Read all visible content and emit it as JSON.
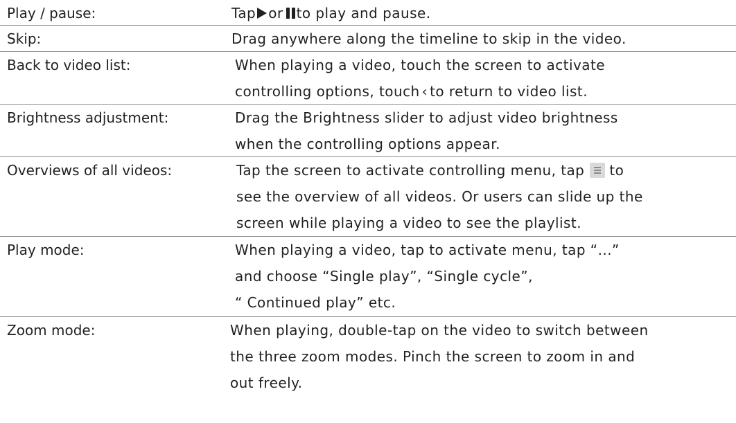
{
  "rows": [
    {
      "label": "Play / pause:",
      "parts": {
        "p1": "Tap",
        "play_icon": "play-icon",
        "p2": "or",
        "pause_icon": "pause-icon",
        "p3": "to play and pause."
      }
    },
    {
      "label": "Skip:",
      "lines": [
        "Drag anywhere along the timeline to skip in the video."
      ]
    },
    {
      "label": "Back to video list:",
      "lines": [
        "When playing a video, touch the screen to activate",
        "controlling options, touch",
        "to return to video list."
      ],
      "back_glyph": "‹",
      "back_icon": "chevron-left-icon"
    },
    {
      "label": "Brightness adjustment:",
      "lines": [
        "Drag the Brightness slider to adjust video brightness",
        "when the controlling options appear."
      ]
    },
    {
      "label": "Overviews of all videos:",
      "lines": [
        "Tap the screen to activate controlling menu, tap",
        "to",
        "see the overview of all videos. Or users can slide up the",
        "screen while playing a video to see the playlist."
      ],
      "menu_icon": "list-menu-icon"
    },
    {
      "label": "Play mode:",
      "lines": [
        "When playing a video, tap to activate menu, tap “...”",
        "and choose “Single play”, “Single cycle”,",
        "“ Continued  play” etc."
      ]
    },
    {
      "label": "Zoom mode:",
      "lines": [
        "When playing, double-tap on the video to switch between",
        "the three zoom modes. Pinch the screen to zoom in and",
        "out freely."
      ]
    }
  ]
}
